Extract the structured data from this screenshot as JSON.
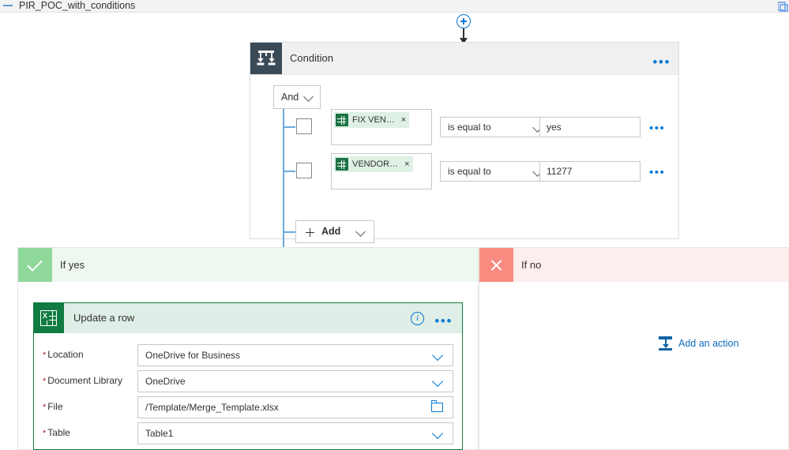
{
  "titlebar": {
    "title": "PIR_POC_with_conditions",
    "collapse_icon": "minus-icon",
    "corner_icon": "window-icon"
  },
  "connector": {
    "add_icon": "plus-circle-icon",
    "arrow_icon": "arrow-down-icon"
  },
  "condition_card": {
    "title": "Condition",
    "icon": "condition-branch-icon",
    "menu": "•••",
    "logic_operator": {
      "value": "And",
      "chevron_icon": "chevron-down-icon"
    },
    "rows": [
      {
        "checkbox_checked": false,
        "token": {
          "icon": "excel-icon",
          "label": "FIX VEN…",
          "remove_icon": "×"
        },
        "operator": "is equal to",
        "operator_chevron_icon": "chevron-down-icon",
        "value": "yes",
        "menu": "•••"
      },
      {
        "checkbox_checked": false,
        "token": {
          "icon": "excel-icon",
          "label": "VENDOR…",
          "remove_icon": "×"
        },
        "operator": "is equal to",
        "operator_chevron_icon": "chevron-down-icon",
        "value": "11277",
        "menu": "•••"
      }
    ],
    "add_button": {
      "label": "Add",
      "plus_icon": "plus-icon",
      "chevron_icon": "chevron-down-icon"
    }
  },
  "branch_yes": {
    "title": "If yes",
    "icon": "checkmark-icon",
    "header_color": "#eef8ef",
    "icon_color": "#8ed99a"
  },
  "branch_no": {
    "title": "If no",
    "icon": "close-x-icon",
    "header_color": "#fdeeee",
    "icon_color": "#f98b80",
    "add_action": {
      "label": "Add an action",
      "icon": "add-action-icon",
      "color": "#0f6cbd"
    }
  },
  "update_card": {
    "title": "Update a row",
    "icon": "excel-icon",
    "info_icon": "info-icon",
    "menu": "•••",
    "accent_color": "#107c41",
    "fields": [
      {
        "label": "Location",
        "required": true,
        "value": "OneDrive for Business",
        "control": "dropdown",
        "trailing_icon": "chevron-down-icon"
      },
      {
        "label": "Document Library",
        "required": true,
        "value": "OneDrive",
        "control": "dropdown",
        "trailing_icon": "chevron-down-icon"
      },
      {
        "label": "File",
        "required": true,
        "value": "/Template/Merge_Template.xlsx",
        "control": "file-picker",
        "trailing_icon": "folder-icon"
      },
      {
        "label": "Table",
        "required": true,
        "value": "Table1",
        "control": "dropdown",
        "trailing_icon": "chevron-down-icon"
      }
    ]
  }
}
